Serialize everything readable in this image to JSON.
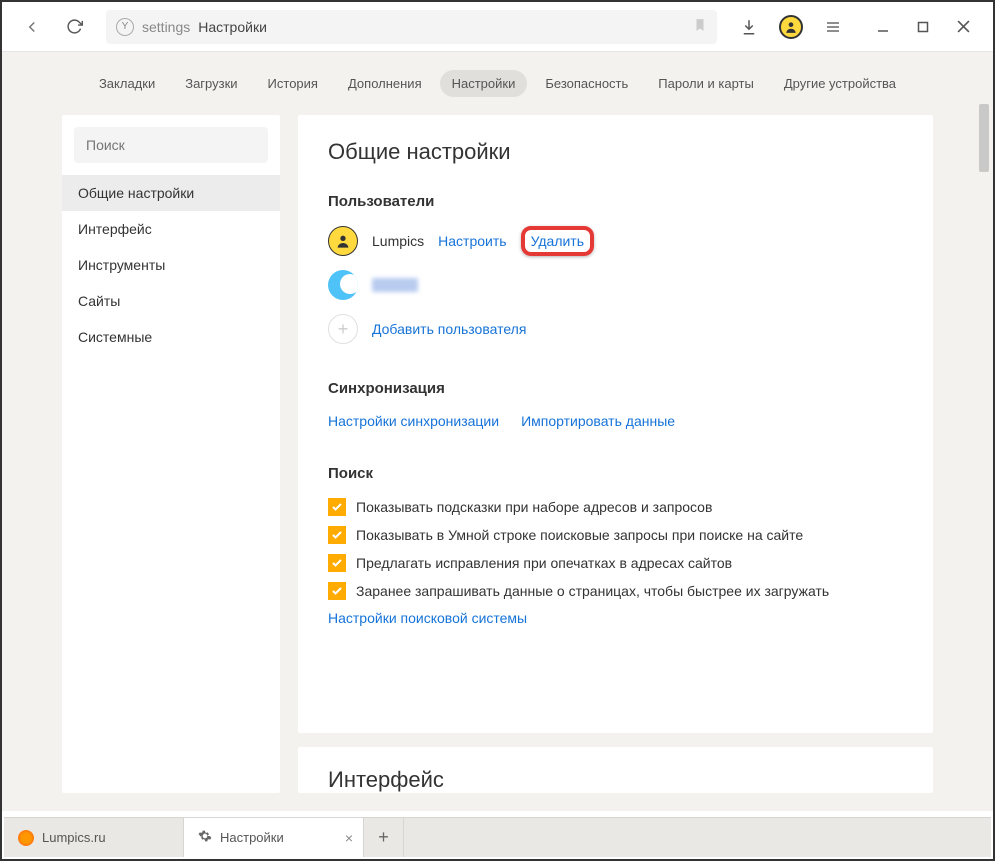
{
  "toolbar": {
    "address_prefix": "settings",
    "address_title": "Настройки"
  },
  "topnav": {
    "items": [
      "Закладки",
      "Загрузки",
      "История",
      "Дополнения",
      "Настройки",
      "Безопасность",
      "Пароли и карты",
      "Другие устройства"
    ],
    "active_index": 4
  },
  "sidebar": {
    "search_placeholder": "Поиск",
    "items": [
      "Общие настройки",
      "Интерфейс",
      "Инструменты",
      "Сайты",
      "Системные"
    ],
    "active_index": 0
  },
  "main": {
    "title": "Общие настройки",
    "users": {
      "heading": "Пользователи",
      "user1_name": "Lumpics",
      "configure": "Настроить",
      "delete": "Удалить",
      "add_user": "Добавить пользователя"
    },
    "sync": {
      "heading": "Синхронизация",
      "settings": "Настройки синхронизации",
      "import": "Импортировать данные"
    },
    "search": {
      "heading": "Поиск",
      "opts": [
        "Показывать подсказки при наборе адресов и запросов",
        "Показывать в Умной строке поисковые запросы при поиске на сайте",
        "Предлагать исправления при опечатках в адресах сайтов",
        "Заранее запрашивать данные о страницах, чтобы быстрее их загружать"
      ],
      "engine_settings": "Настройки поисковой системы"
    },
    "next_section_title": "Интерфейс"
  },
  "tabs": {
    "tab1": "Lumpics.ru",
    "tab2": "Настройки"
  }
}
